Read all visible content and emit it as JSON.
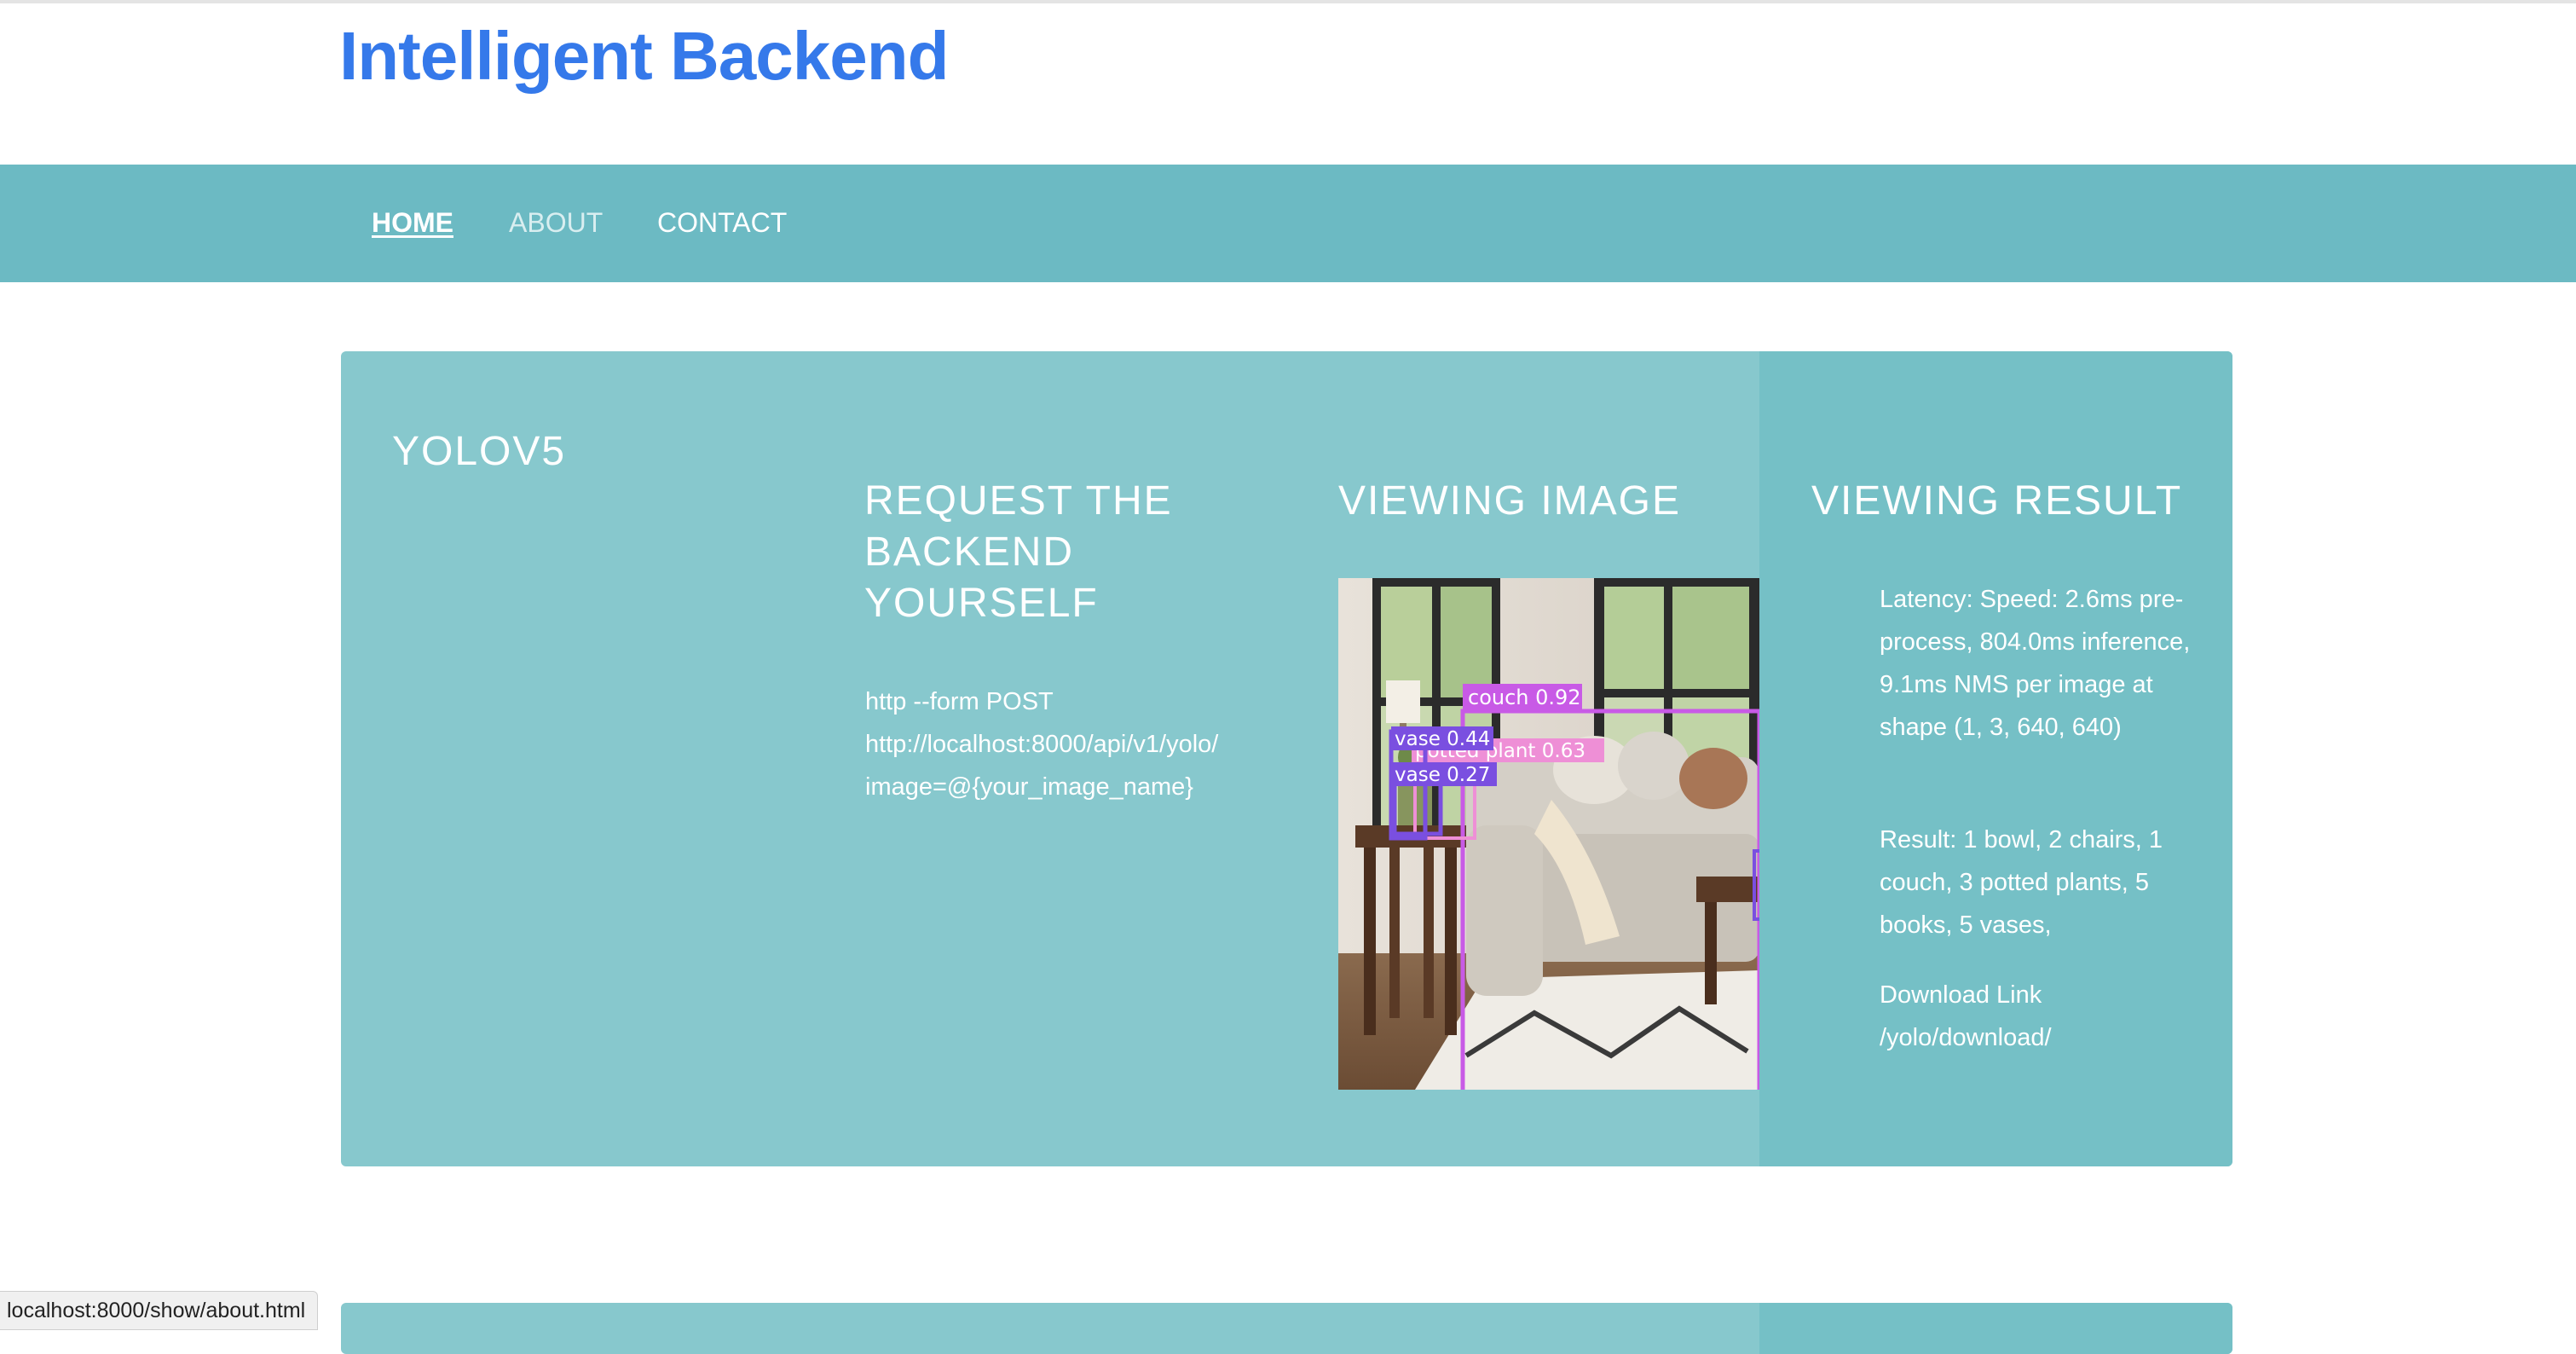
{
  "site": {
    "title": "Intelligent Backend"
  },
  "nav": {
    "home": "HOME",
    "about": "ABOUT",
    "contact": "CONTACT"
  },
  "panel": {
    "title": "YOLOV5",
    "request": {
      "heading": "REQUEST THE BACKEND YOURSELF",
      "command_line1": "http --form POST",
      "command_line2": "http://localhost:8000/api/v1/yolo/",
      "command_line3": "image=@{your_image_name}"
    },
    "viewer": {
      "heading": "VIEWING IMAGE",
      "detections": [
        {
          "label": "couch 0.92",
          "color": "#c85ae6"
        },
        {
          "label": "potted plant 0.63",
          "color": "#ee8fd6"
        },
        {
          "label": "vase 0.44",
          "color": "#7a4fe0"
        },
        {
          "label": "vase 0.27",
          "color": "#7a4fe0"
        }
      ]
    },
    "result": {
      "heading": "VIEWING RESULT",
      "latency": "Latency: Speed: 2.6ms pre-process, 804.0ms inference, 9.1ms NMS per image at shape (1, 3, 640, 640)",
      "summary": "Result: 1 bowl, 2 chairs, 1 couch, 3 potted plants, 5 books, 5 vases,",
      "download_label": "Download Link",
      "download_path": "/yolo/download/"
    }
  },
  "status_bar": {
    "url": "localhost:8000/show/about.html"
  },
  "colors": {
    "brand": "#3579ea",
    "nav_bg": "#6cbac3",
    "panel_bg": "#87c8cd",
    "panel_right_bg": "#75c0c6"
  }
}
